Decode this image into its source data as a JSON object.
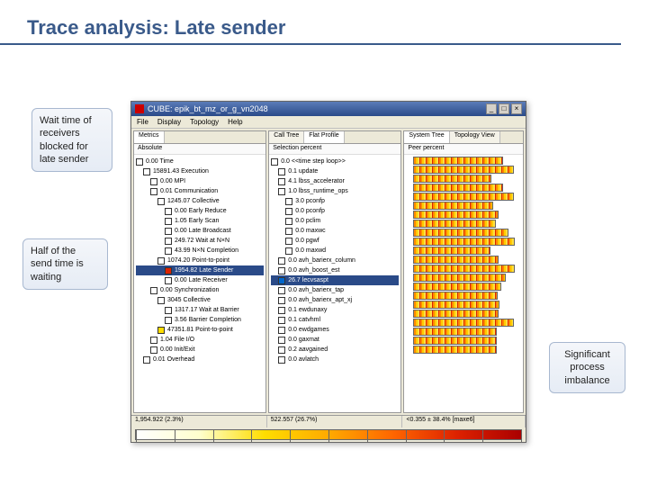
{
  "slide": {
    "title": "Trace analysis: Late sender"
  },
  "callouts": {
    "c1": "Wait time of receivers blocked for late sender",
    "c2": "Half of the send time is waiting",
    "c3": "Significant process imbalance"
  },
  "window": {
    "title": "CUBE: epik_bt_mz_or_g_vn2048",
    "menu": [
      "File",
      "Display",
      "Topology",
      "Help"
    ],
    "winbtns": [
      "_",
      "□",
      "×"
    ]
  },
  "panel_left": {
    "tab": "Metrics",
    "dropdown": "Absolute",
    "rows": [
      {
        "ind": 0,
        "color": "white",
        "label": "0.00 Time"
      },
      {
        "ind": 1,
        "color": "white",
        "label": "15891.43 Execution"
      },
      {
        "ind": 2,
        "color": "white",
        "label": "0.00 MPI"
      },
      {
        "ind": 2,
        "color": "white",
        "label": "0.01 Communication"
      },
      {
        "ind": 3,
        "color": "white",
        "label": "1245.07 Collective"
      },
      {
        "ind": 4,
        "color": "white",
        "label": "0.00 Early Reduce"
      },
      {
        "ind": 4,
        "color": "white",
        "label": "1.05 Early Scan"
      },
      {
        "ind": 4,
        "color": "white",
        "label": "0.00 Late Broadcast"
      },
      {
        "ind": 4,
        "color": "white",
        "label": "249.72 Wait at N×N"
      },
      {
        "ind": 4,
        "color": "white",
        "label": "43.99 N×N Completion"
      },
      {
        "ind": 3,
        "color": "white",
        "label": "1074.20 Point-to-point"
      },
      {
        "ind": 4,
        "color": "red",
        "label": "1954.82 Late Sender",
        "sel": true
      },
      {
        "ind": 4,
        "color": "white",
        "label": "0.00 Late Receiver"
      },
      {
        "ind": 2,
        "color": "white",
        "label": "0.00 Synchronization"
      },
      {
        "ind": 3,
        "color": "white",
        "label": "3045 Collective"
      },
      {
        "ind": 4,
        "color": "white",
        "label": "1317.17 Wait at Barrier"
      },
      {
        "ind": 4,
        "color": "white",
        "label": "3.56 Barrier Completion"
      },
      {
        "ind": 3,
        "color": "yellow",
        "label": "47351.81 Point-to-point"
      },
      {
        "ind": 2,
        "color": "white",
        "label": "1.04 File I/O"
      },
      {
        "ind": 2,
        "color": "white",
        "label": "0.00 Init/Exit"
      },
      {
        "ind": 1,
        "color": "white",
        "label": "0.01 Overhead"
      }
    ]
  },
  "panel_mid": {
    "tabs": [
      "Call Tree",
      "Flat Profile"
    ],
    "active_tab": 1,
    "dropdown": "Selection percent",
    "rows": [
      {
        "ind": 0,
        "color": "white",
        "label": "0.0 <<time step loop>>"
      },
      {
        "ind": 1,
        "color": "white",
        "label": "0.1 update"
      },
      {
        "ind": 1,
        "color": "white",
        "label": "4.1 lbss_accelerator"
      },
      {
        "ind": 1,
        "color": "white",
        "label": "1.0 lbss_runtime_ops"
      },
      {
        "ind": 2,
        "color": "white",
        "label": "3.0 pconfp"
      },
      {
        "ind": 2,
        "color": "white",
        "label": "0.0 pconfp"
      },
      {
        "ind": 2,
        "color": "white",
        "label": "0.0 pclim"
      },
      {
        "ind": 2,
        "color": "white",
        "label": "0.0 maxwc"
      },
      {
        "ind": 2,
        "color": "white",
        "label": "0.0 pgwf"
      },
      {
        "ind": 2,
        "color": "white",
        "label": "0.0 maxwd"
      },
      {
        "ind": 1,
        "color": "white",
        "label": "0.0 avh_barierx_column"
      },
      {
        "ind": 1,
        "color": "white",
        "label": "0.0 avh_boost_est"
      },
      {
        "ind": 1,
        "color": "blue",
        "label": "26.7 lecvsaspt",
        "sel": true
      },
      {
        "ind": 1,
        "color": "white",
        "label": "0.0 avh_barierx_tap"
      },
      {
        "ind": 1,
        "color": "white",
        "label": "0.0 avh_barierx_apt_xj"
      },
      {
        "ind": 1,
        "color": "white",
        "label": "0.1 ewdunaxy"
      },
      {
        "ind": 1,
        "color": "white",
        "label": "0.1 catvhml"
      },
      {
        "ind": 1,
        "color": "white",
        "label": "0.0 ewdgames"
      },
      {
        "ind": 1,
        "color": "white",
        "label": "0.0 gaxmat"
      },
      {
        "ind": 1,
        "color": "white",
        "label": "0.2 aavgained"
      },
      {
        "ind": 1,
        "color": "white",
        "label": "0.0 avlatch"
      }
    ]
  },
  "panel_right": {
    "tabs": [
      "System Tree",
      "Topology View"
    ],
    "active_tab": 0,
    "dropdown": "Peer percent",
    "heatmap_rows": 22
  },
  "status": {
    "left": "1,954.922  (2.3%)",
    "left_bar_pct": 12,
    "mid": "522.557  (26.7%)",
    "mid_bar_pct": 28,
    "right": "<0.355 ± 38.4%  [maxe6]"
  },
  "colorbar_ticks": 11
}
